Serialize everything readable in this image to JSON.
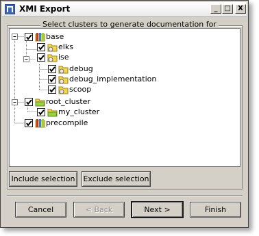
{
  "window": {
    "title": "XMI Export",
    "minimize_glyph": "_",
    "maximize_glyph": "□",
    "close_glyph": "X"
  },
  "group": {
    "legend": "Select clusters to generate documentation for"
  },
  "tree": {
    "nodes": [
      {
        "label": "base",
        "checked": true,
        "expander": "minus",
        "icon": "library-cluster-icon"
      },
      {
        "label": "elks",
        "checked": true,
        "icon": "cluster-folder-icon"
      },
      {
        "label": "ise",
        "checked": true,
        "expander": "minus",
        "icon": "cluster-folder-icon"
      },
      {
        "label": "debug",
        "checked": true,
        "icon": "cluster-folder-icon"
      },
      {
        "label": "debug_implementation",
        "checked": true,
        "icon": "cluster-folder-icon"
      },
      {
        "label": "scoop",
        "checked": true,
        "icon": "cluster-folder-icon"
      },
      {
        "label": "root_cluster",
        "checked": true,
        "expander": "minus",
        "icon": "folder-icon"
      },
      {
        "label": "my_cluster",
        "checked": true,
        "icon": "folder-icon"
      },
      {
        "label": "precompile",
        "checked": true,
        "icon": "library-cluster-icon"
      }
    ]
  },
  "selection_buttons": {
    "include": "Include selection",
    "exclude": "Exclude selection"
  },
  "footer": {
    "cancel": "Cancel",
    "back": "< Back",
    "next": "Next >",
    "finish": "Finish"
  },
  "colors": {
    "dialog_face": "#d4d0c8",
    "folder_yellow": "#f3d64a",
    "folder_green": "#9ad13f",
    "library_red": "#c0392b"
  }
}
